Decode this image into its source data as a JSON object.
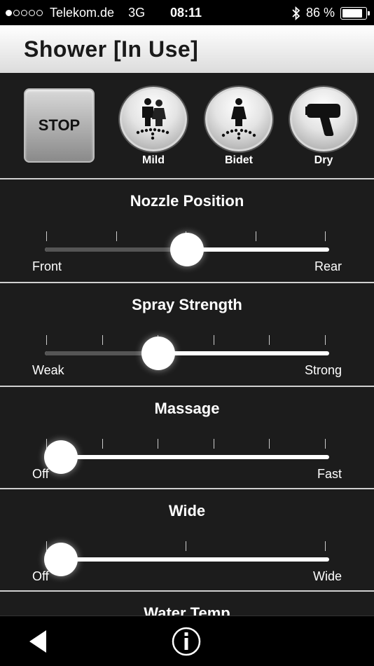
{
  "status": {
    "carrier": "Telekom.de",
    "network": "3G",
    "time": "08:11",
    "battery": "86 %",
    "battery_level": 0.86,
    "bluetooth_icon": "bluetooth-icon"
  },
  "header": {
    "title": "Shower [In Use]"
  },
  "modes": {
    "stop_label": "STOP",
    "items": [
      {
        "label": "Mild",
        "icon": "mild-icon"
      },
      {
        "label": "Bidet",
        "icon": "bidet-icon"
      },
      {
        "label": "Dry",
        "icon": "dryer-icon"
      }
    ]
  },
  "sliders": [
    {
      "title": "Nozzle Position",
      "min_label": "Front",
      "max_label": "Rear",
      "ticks": 5,
      "value": 0.5
    },
    {
      "title": "Spray Strength",
      "min_label": "Weak",
      "max_label": "Strong",
      "ticks": 6,
      "value": 0.4
    },
    {
      "title": "Massage",
      "min_label": "Off",
      "max_label": "Fast",
      "ticks": 6,
      "value": 0.0
    },
    {
      "title": "Wide",
      "min_label": "Off",
      "max_label": "Wide",
      "ticks": 3,
      "value": 0.0
    }
  ],
  "water_temp": {
    "title": "Water Temp"
  },
  "bottom": {
    "back_icon": "back-icon",
    "info_icon": "info-icon"
  }
}
